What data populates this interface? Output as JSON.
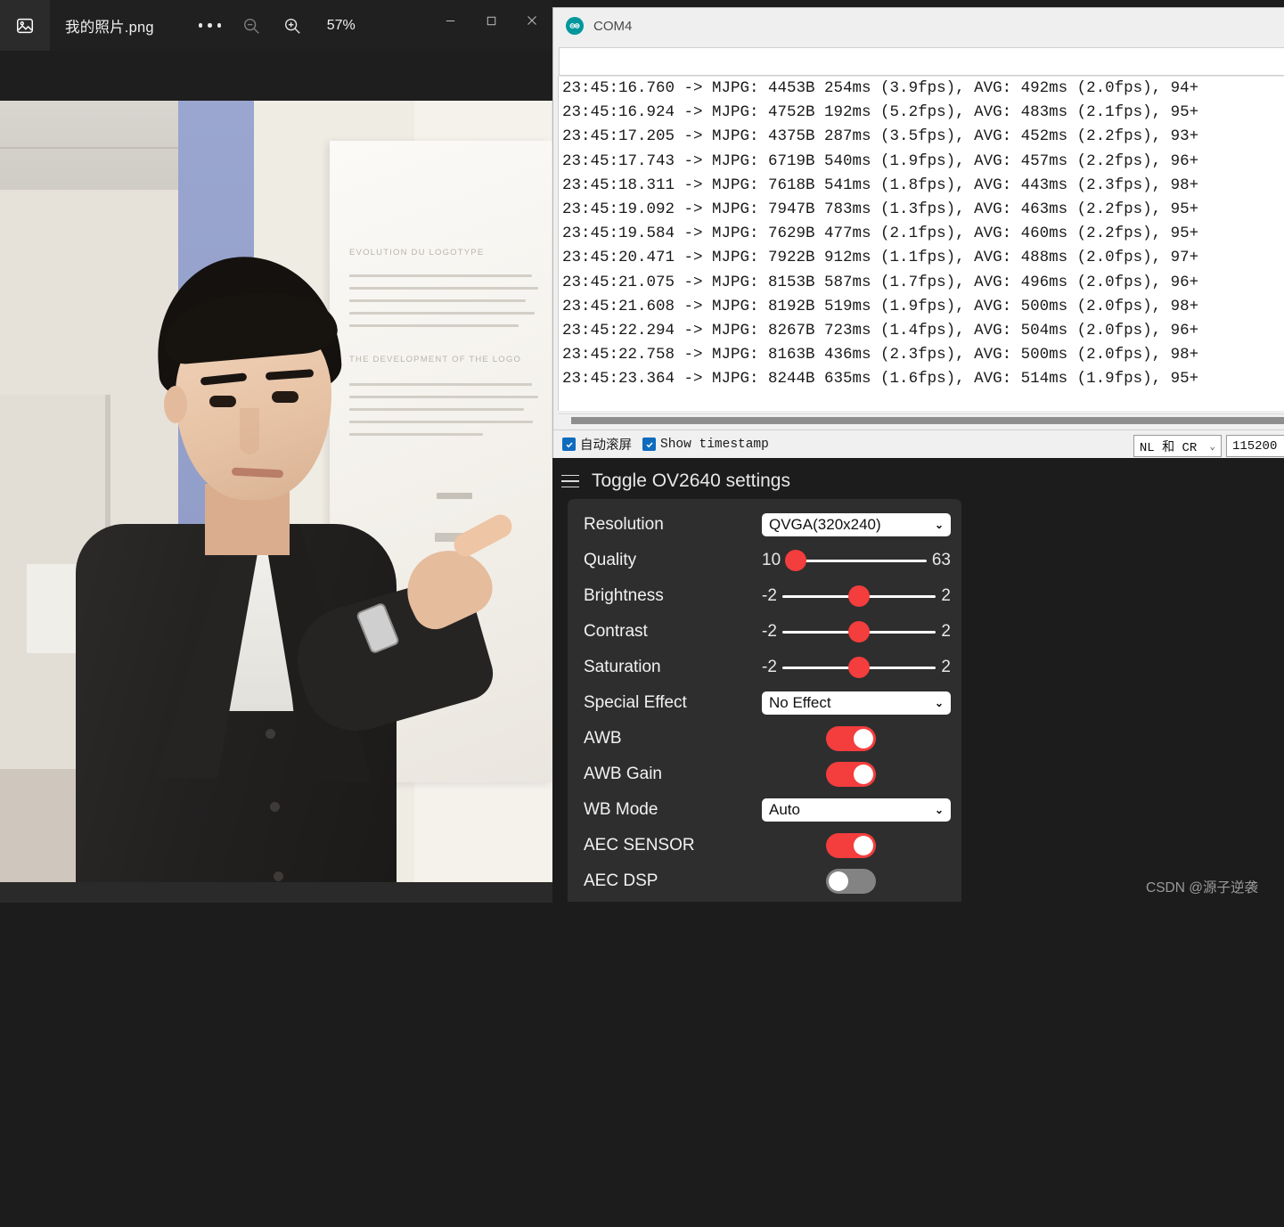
{
  "photo_viewer": {
    "app_icon": "image-icon",
    "filename": "我的照片.png",
    "more_label": "…",
    "zoom_out_icon": "zoom-out-icon",
    "zoom_in_icon": "zoom-in-icon",
    "zoom_level": "57%",
    "minimize_icon": "minimize-icon",
    "maximize_icon": "maximize-icon",
    "close_icon": "close-icon"
  },
  "serial_monitor": {
    "app_icon": "arduino-infinity-icon",
    "title": "COM4",
    "send_input_value": "",
    "send_input_placeholder": "",
    "log_lines": [
      "23:45:16.760 -> MJPG: 4453B 254ms (3.9fps), AVG: 492ms (2.0fps), 94+",
      "23:45:16.924 -> MJPG: 4752B 192ms (5.2fps), AVG: 483ms (2.1fps), 95+",
      "23:45:17.205 -> MJPG: 4375B 287ms (3.5fps), AVG: 452ms (2.2fps), 93+",
      "23:45:17.743 -> MJPG: 6719B 540ms (1.9fps), AVG: 457ms (2.2fps), 96+",
      "23:45:18.311 -> MJPG: 7618B 541ms (1.8fps), AVG: 443ms (2.3fps), 98+",
      "23:45:19.092 -> MJPG: 7947B 783ms (1.3fps), AVG: 463ms (2.2fps), 95+",
      "23:45:19.584 -> MJPG: 7629B 477ms (2.1fps), AVG: 460ms (2.2fps), 95+",
      "23:45:20.471 -> MJPG: 7922B 912ms (1.1fps), AVG: 488ms (2.0fps), 97+",
      "23:45:21.075 -> MJPG: 8153B 587ms (1.7fps), AVG: 496ms (2.0fps), 96+",
      "23:45:21.608 -> MJPG: 8192B 519ms (1.9fps), AVG: 500ms (2.0fps), 98+",
      "23:45:22.294 -> MJPG: 8267B 723ms (1.4fps), AVG: 504ms (2.0fps), 96+",
      "23:45:22.758 -> MJPG: 8163B 436ms (2.3fps), AVG: 500ms (2.0fps), 98+",
      "23:45:23.364 -> MJPG: 8244B 635ms (1.6fps), AVG: 514ms (1.9fps), 95+"
    ],
    "autoscroll_label": "自动滚屏",
    "autoscroll_checked": "✓",
    "timestamp_label": "Show timestamp",
    "timestamp_checked": "✓",
    "line_ending": "NL 和 CR",
    "baud_rate": "115200",
    "caret": "⌄"
  },
  "ov2640": {
    "header_title": "Toggle OV2640 settings",
    "hamburger_icon": "hamburger-icon",
    "rows": [
      {
        "label": "Resolution",
        "type": "select",
        "value": "QVGA(320x240)"
      },
      {
        "label": "Quality",
        "type": "slider",
        "min": "10",
        "max": "63",
        "pos": 7
      },
      {
        "label": "Brightness",
        "type": "slider",
        "min": "-2",
        "max": "2",
        "pos": 50
      },
      {
        "label": "Contrast",
        "type": "slider",
        "min": "-2",
        "max": "2",
        "pos": 50
      },
      {
        "label": "Saturation",
        "type": "slider",
        "min": "-2",
        "max": "2",
        "pos": 50
      },
      {
        "label": "Special Effect",
        "type": "select",
        "value": "No Effect"
      },
      {
        "label": "AWB",
        "type": "toggle",
        "state": "on"
      },
      {
        "label": "AWB Gain",
        "type": "toggle",
        "state": "on"
      },
      {
        "label": "WB Mode",
        "type": "select",
        "value": "Auto"
      },
      {
        "label": "AEC SENSOR",
        "type": "toggle",
        "state": "on"
      },
      {
        "label": "AEC DSP",
        "type": "toggle",
        "state": "off"
      }
    ],
    "caret": "⌄",
    "colors": {
      "accent_red": "#f43d3d",
      "toggle_off": "#838383",
      "card_bg": "#2e2e2e",
      "page_bg": "#1c1c1c"
    }
  },
  "stream": {
    "close_icon": "close-circle-icon",
    "close_label": "✕",
    "face_box_color": "#ffe400"
  },
  "watermark": "CSDN @源子逆袭"
}
